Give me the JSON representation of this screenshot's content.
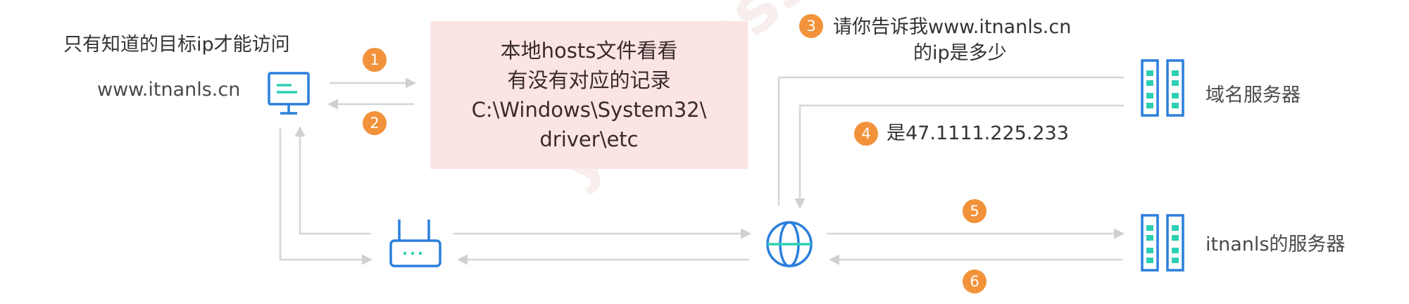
{
  "client": {
    "note": "只有知道的目标ip才能访问",
    "domain": "www.itnanls.cn"
  },
  "hosts_box": {
    "lines": [
      "本地hosts文件看看",
      "有没有对应的记录",
      "C:\\Windows\\System32\\",
      "driver\\etc"
    ]
  },
  "steps": [
    "1",
    "2",
    "3",
    "4",
    "5",
    "6"
  ],
  "step3_text": {
    "line1": "请你告诉我www.itnanls.cn",
    "line2": "的ip是多少"
  },
  "step4_text": "是47.1111.225.233",
  "dns_server_label": "域名服务器",
  "web_server_label": "itnanls的服务器",
  "watermark": "ydlclass.com",
  "colors": {
    "accent_blue": "#2b7fdc",
    "server_green": "#2dcfb2",
    "step_orange": "#f2923a",
    "arrow_gray": "#d0d0d0",
    "hosts_bg": "#fce4e4"
  }
}
